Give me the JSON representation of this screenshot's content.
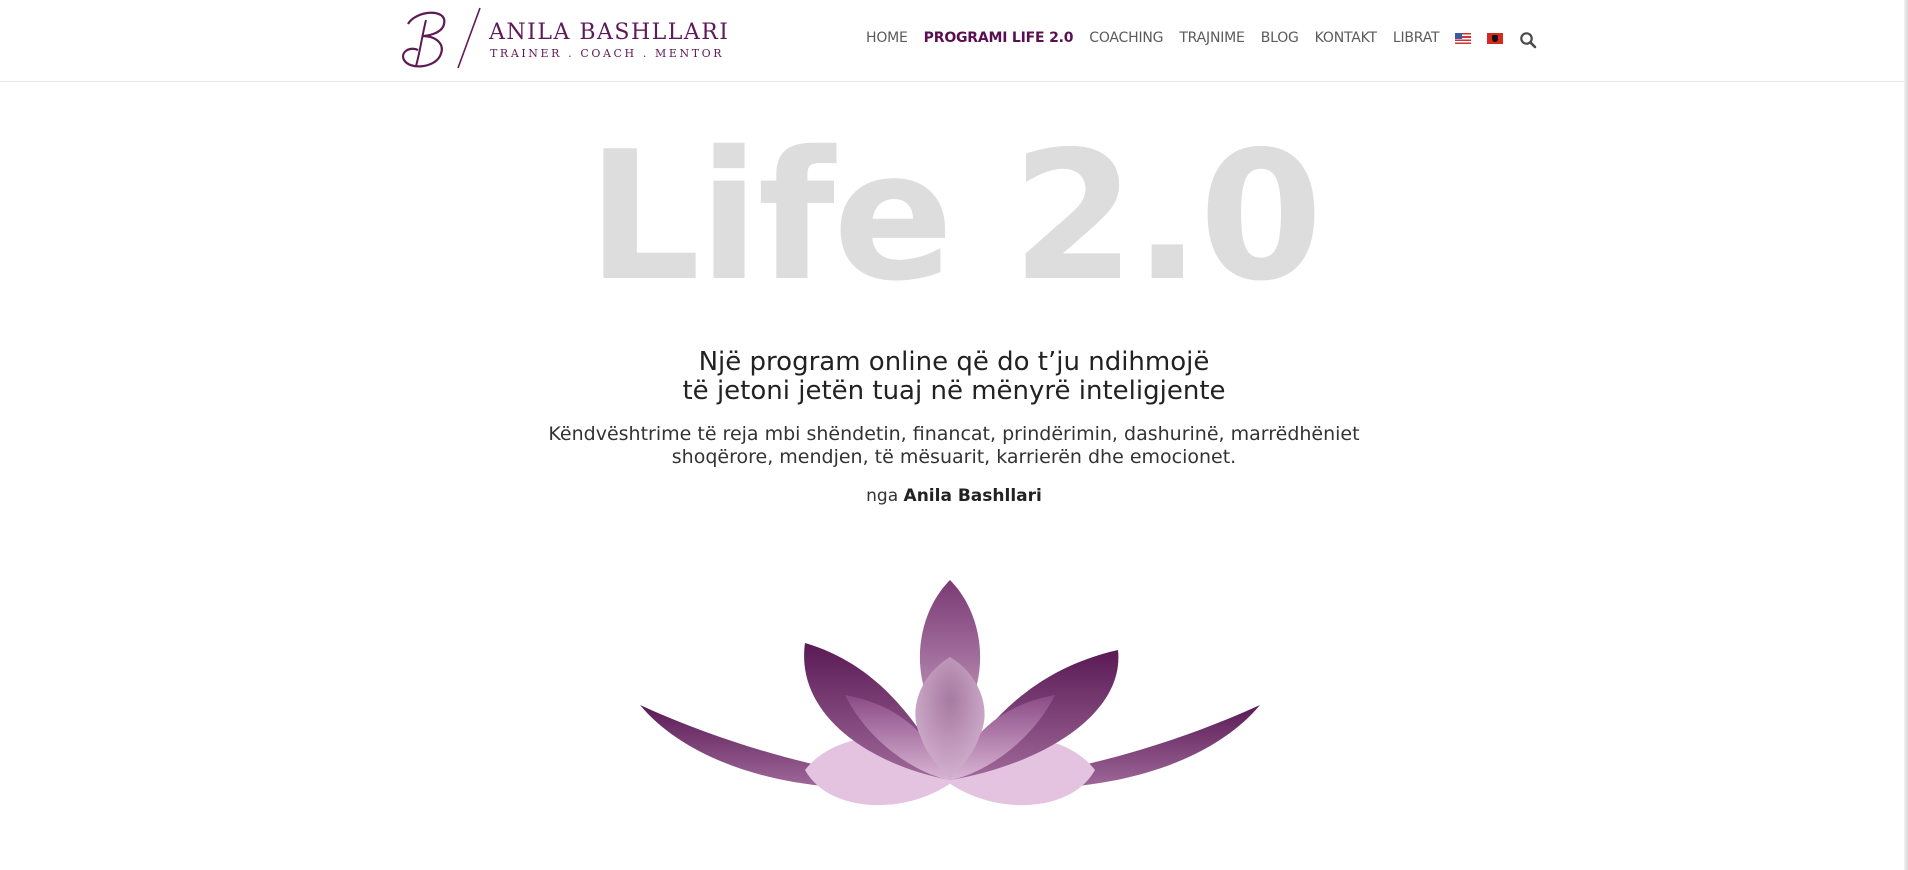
{
  "brand": {
    "name": "ANILA BASHLLARI",
    "tagline": "TRAINER . COACH . MENTOR",
    "color": "#5e1a57"
  },
  "nav": {
    "items": [
      {
        "label": "HOME",
        "active": false
      },
      {
        "label": "PROGRAMI LIFE 2.0",
        "active": true
      },
      {
        "label": "COACHING",
        "active": false
      },
      {
        "label": "TRAJNIME",
        "active": false
      },
      {
        "label": "BLOG",
        "active": false
      },
      {
        "label": "KONTAKT",
        "active": false
      },
      {
        "label": "LIBRAT",
        "active": false
      }
    ],
    "languages": [
      "flag-us-icon",
      "flag-al-icon"
    ],
    "search_icon": "search-icon"
  },
  "hero": {
    "title": "Life 2.0",
    "headline_line1": "Një program online që do t’ju ndihmojë",
    "headline_line2": "të jetoni jetën tuaj në mënyrë inteligjente",
    "description_line1": "Këndvështrime të reja mbi shëndetin, financat, prindërimin, dashurinë, marrëdhëniet",
    "description_line2": "shoqërore, mendjen, të mësuarit, karrierën dhe emocionet.",
    "author_prefix": "nga",
    "author_name": "Anila Bashllari"
  },
  "colors": {
    "accent": "#5a1050",
    "title_gray": "#dddddd",
    "lotus_dark": "#5a1a55",
    "lotus_light": "#e3c3df"
  }
}
